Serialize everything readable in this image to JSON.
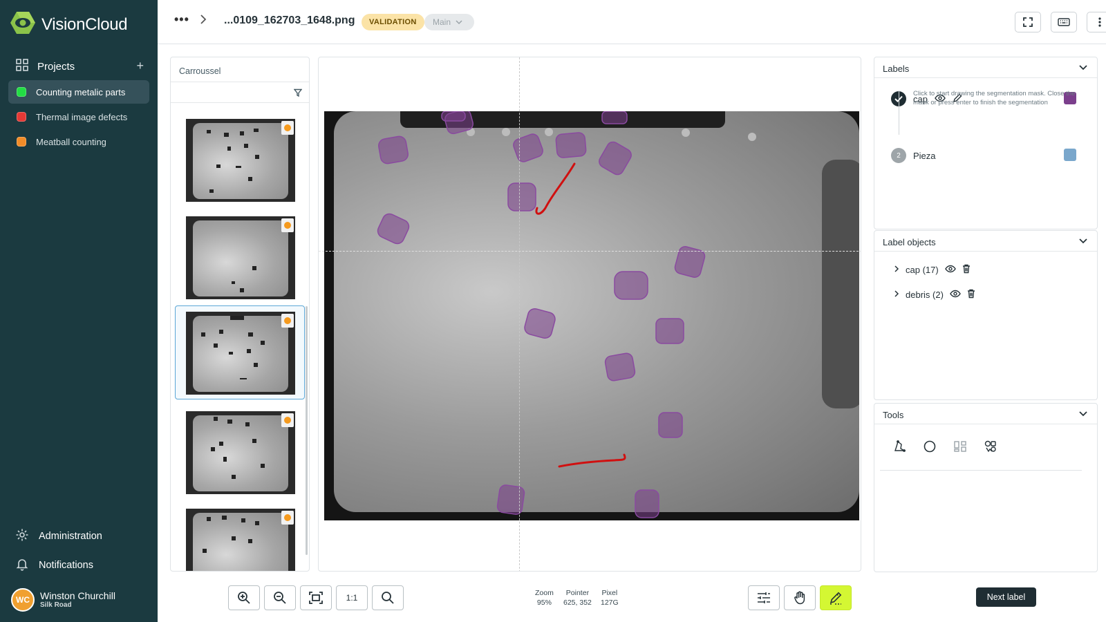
{
  "app": {
    "name": "VisionCloud"
  },
  "sidebar": {
    "projects_label": "Projects",
    "projects": [
      {
        "name": "Counting metalic parts",
        "color": "#22dd44",
        "active": true
      },
      {
        "name": "Thermal image defects",
        "color": "#e53935",
        "active": false
      },
      {
        "name": "Meatball counting",
        "color": "#f28c28",
        "active": false
      }
    ],
    "administration": "Administration",
    "notifications": "Notifications",
    "user": {
      "initials": "WC",
      "name": "Winston Churchill",
      "org": "Silk Road"
    }
  },
  "header": {
    "ellipsis": "•••",
    "filename": "...0109_162703_1648.png",
    "status_badge": "VALIDATION",
    "branch": "Main"
  },
  "carousel": {
    "title": "Carroussel",
    "selected_index": 2
  },
  "labels_panel": {
    "title": "Labels",
    "labels": [
      {
        "name": "cap",
        "color": "#7b3f8c",
        "active": true
      },
      {
        "name": "Pieza",
        "index": "2",
        "color": "#7aa7cc",
        "active": false
      }
    ],
    "hint": "Click to start drawing the segmentation mask. Close the mask or press enter to finish the segmentation"
  },
  "objects_panel": {
    "title": "Label objects",
    "objects": [
      {
        "name": "cap (17)"
      },
      {
        "name": "debris (2)"
      }
    ]
  },
  "tools_panel": {
    "title": "Tools"
  },
  "toolbar": {
    "one_to_one": "1:1",
    "zoom_label": "Zoom",
    "zoom_value": "95%",
    "pointer_label": "Pointer",
    "pointer_value": "625, 352",
    "pixel_label": "Pixel",
    "pixel_value": "127G",
    "next_label": "Next label"
  },
  "colors": {
    "sidebar_bg": "#1b3a40",
    "accent_draw": "#d4f733",
    "cap_mask": "#7b3f8c",
    "debris_mask": "#d01010"
  }
}
